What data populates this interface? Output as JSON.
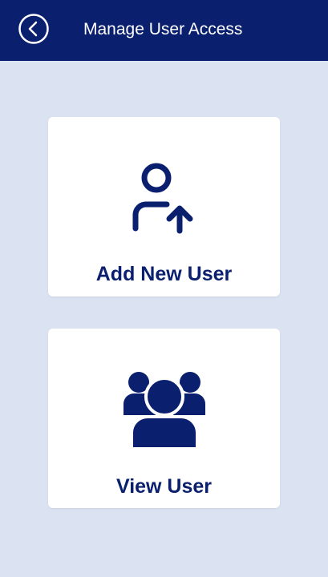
{
  "header": {
    "title": "Manage User Access",
    "back_icon": "chevron-left-circle-icon"
  },
  "cards": [
    {
      "label": "Add New User",
      "icon": "add-user-icon"
    },
    {
      "label": "View User",
      "icon": "user-group-icon"
    }
  ],
  "colors": {
    "header_bg": "#0a1f6e",
    "page_bg": "#dbe3f3",
    "card_bg": "#ffffff",
    "accent": "#0a1f6e"
  }
}
